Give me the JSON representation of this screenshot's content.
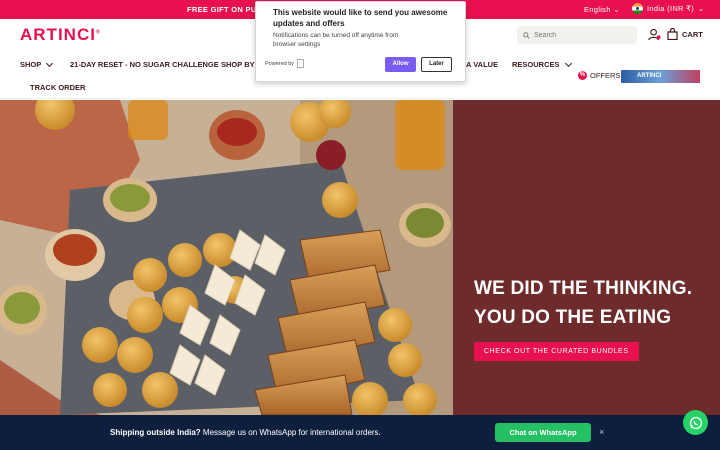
{
  "announcement": {
    "promo": "FREE GIFT ON PURCHAS",
    "language": "English",
    "country": "India (INR ₹)"
  },
  "header": {
    "logo": "ARTINCI",
    "logo_mark": "®",
    "search_placeholder": "Search",
    "cart_label": "CART"
  },
  "nav": {
    "items": [
      {
        "label": "SHOP"
      },
      {
        "label": "21-DAY RESET - NO SUGAR CHALLENGE"
      },
      {
        "label": "SHOP BY C"
      },
      {
        "label": "A VALUE"
      },
      {
        "label": "RESOURCES"
      },
      {
        "label": "TRACK ORDER"
      }
    ],
    "offers_label": "OFFERS",
    "offers_badge": "%",
    "banner_label": "ARTINCI"
  },
  "hero": {
    "headline_line1": "WE DID THE THINKING.",
    "headline_line2": "YOU DO THE EATING",
    "cta_label": "CHECK OUT THE CURATED BUNDLES"
  },
  "bottom_bar": {
    "icon_glyph": "",
    "question": "Shipping outside India?",
    "message": "Message us on WhatsApp for international orders.",
    "button_label": "Chat on WhatsApp",
    "close_label": "×"
  },
  "popup": {
    "title": "This website would like to send you awesome updates and offers",
    "subtitle": "Notifications can be turned off anytime from browser settings",
    "powered_by": "Powered by",
    "allow_label": "Allow",
    "later_label": "Later"
  },
  "colors": {
    "brand": "#e8104e",
    "hero_panel": "#6e2b2b",
    "bottom_bar": "#0d1f3c",
    "whatsapp": "#25c063",
    "allow_button": "#7a5cf0"
  },
  "icons": [
    "search-icon",
    "user-icon",
    "cart-icon",
    "chevron-down-icon",
    "flag-icon",
    "whatsapp-icon",
    "close-icon"
  ]
}
